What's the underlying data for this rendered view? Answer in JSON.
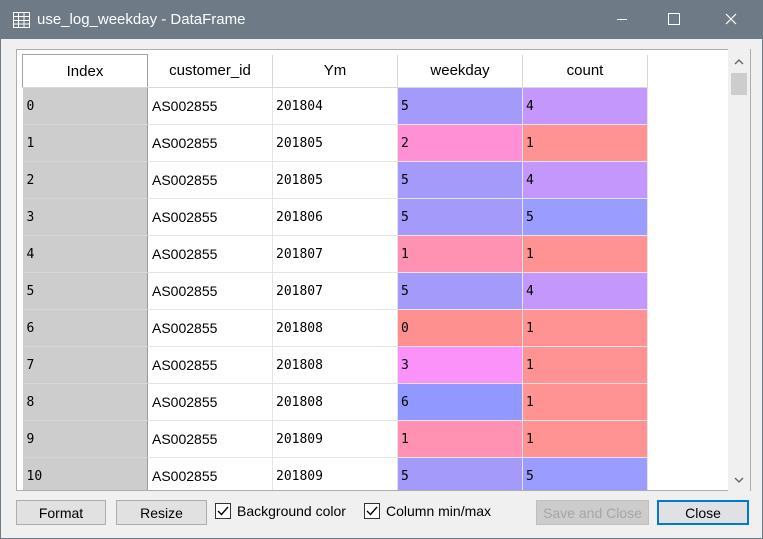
{
  "window": {
    "title": "use_log_weekday - DataFrame"
  },
  "table": {
    "columns": [
      "Index",
      "customer_id",
      "Ym",
      "weekday",
      "count"
    ],
    "rows": [
      {
        "index": "0",
        "customer_id": "AS002855",
        "ym": "201804",
        "weekday": "5",
        "count": "4"
      },
      {
        "index": "1",
        "customer_id": "AS002855",
        "ym": "201805",
        "weekday": "2",
        "count": "1"
      },
      {
        "index": "2",
        "customer_id": "AS002855",
        "ym": "201805",
        "weekday": "5",
        "count": "4"
      },
      {
        "index": "3",
        "customer_id": "AS002855",
        "ym": "201806",
        "weekday": "5",
        "count": "5"
      },
      {
        "index": "4",
        "customer_id": "AS002855",
        "ym": "201807",
        "weekday": "1",
        "count": "1"
      },
      {
        "index": "5",
        "customer_id": "AS002855",
        "ym": "201807",
        "weekday": "5",
        "count": "4"
      },
      {
        "index": "6",
        "customer_id": "AS002855",
        "ym": "201808",
        "weekday": "0",
        "count": "1"
      },
      {
        "index": "7",
        "customer_id": "AS002855",
        "ym": "201808",
        "weekday": "3",
        "count": "1"
      },
      {
        "index": "8",
        "customer_id": "AS002855",
        "ym": "201808",
        "weekday": "6",
        "count": "1"
      },
      {
        "index": "9",
        "customer_id": "AS002855",
        "ym": "201809",
        "weekday": "1",
        "count": "1"
      },
      {
        "index": "10",
        "customer_id": "AS002855",
        "ym": "201809",
        "weekday": "5",
        "count": "5"
      }
    ],
    "cell_colors": {
      "weekday": {
        "0": "#ff9090",
        "1": "#ff92b2",
        "2": "#ff90d6",
        "3": "#fb92fa",
        "5": "#a39afa",
        "6": "#9198ff"
      },
      "count": {
        "1": "#ff9393",
        "4": "#c497fc",
        "5": "#9a9cff"
      }
    }
  },
  "footer": {
    "format_label": "Format",
    "resize_label": "Resize",
    "background_color_label": "Background color",
    "background_color_checked": true,
    "column_minmax_label": "Column min/max",
    "column_minmax_checked": true,
    "save_close_label": "Save and Close",
    "close_label": "Close"
  },
  "icons": {
    "app": "table-grid-icon",
    "minimize": "minimize-icon",
    "maximize": "maximize-icon",
    "close": "close-icon",
    "scroll_up": "chevron-up-icon",
    "scroll_down": "chevron-down-icon",
    "checkmark": "checkmark-icon"
  }
}
